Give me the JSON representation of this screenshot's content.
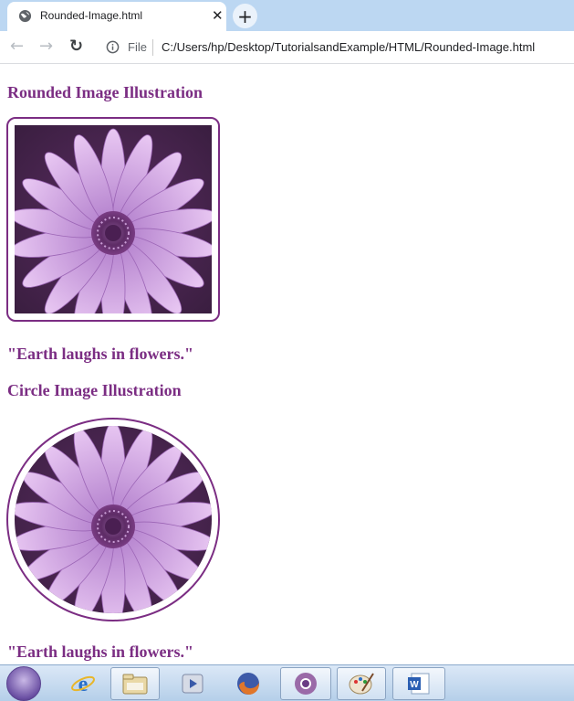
{
  "browser": {
    "tab_title": "Rounded-Image.html",
    "close_glyph": "✕",
    "new_tab_glyph": "+",
    "back_glyph": "←",
    "forward_glyph": "→",
    "reload_glyph": "↻",
    "file_label": "File",
    "address": "C:/Users/hp/Desktop/TutorialsandExample/HTML/Rounded-Image.html"
  },
  "page": {
    "heading_rounded": "Rounded Image Illustration",
    "caption_rounded": "\"Earth laughs in flowers.\"",
    "heading_circle": "Circle Image Illustration",
    "caption_circle": "\"Earth laughs in flowers.\""
  },
  "icons": {
    "favicon": "globe-icon",
    "info": "info-icon",
    "back": "arrow-left-icon",
    "forward": "arrow-right-icon",
    "reload": "reload-icon"
  },
  "colors": {
    "accent": "#7b2d83",
    "tabstrip": "#bcd7f2",
    "taskbar": "#c9dcf0"
  },
  "taskbar": {
    "items": [
      "start-orb-icon",
      "internet-explorer-icon",
      "file-explorer-icon",
      "media-player-icon",
      "firefox-icon",
      "chrome-icon",
      "paint-icon",
      "word-icon"
    ]
  }
}
